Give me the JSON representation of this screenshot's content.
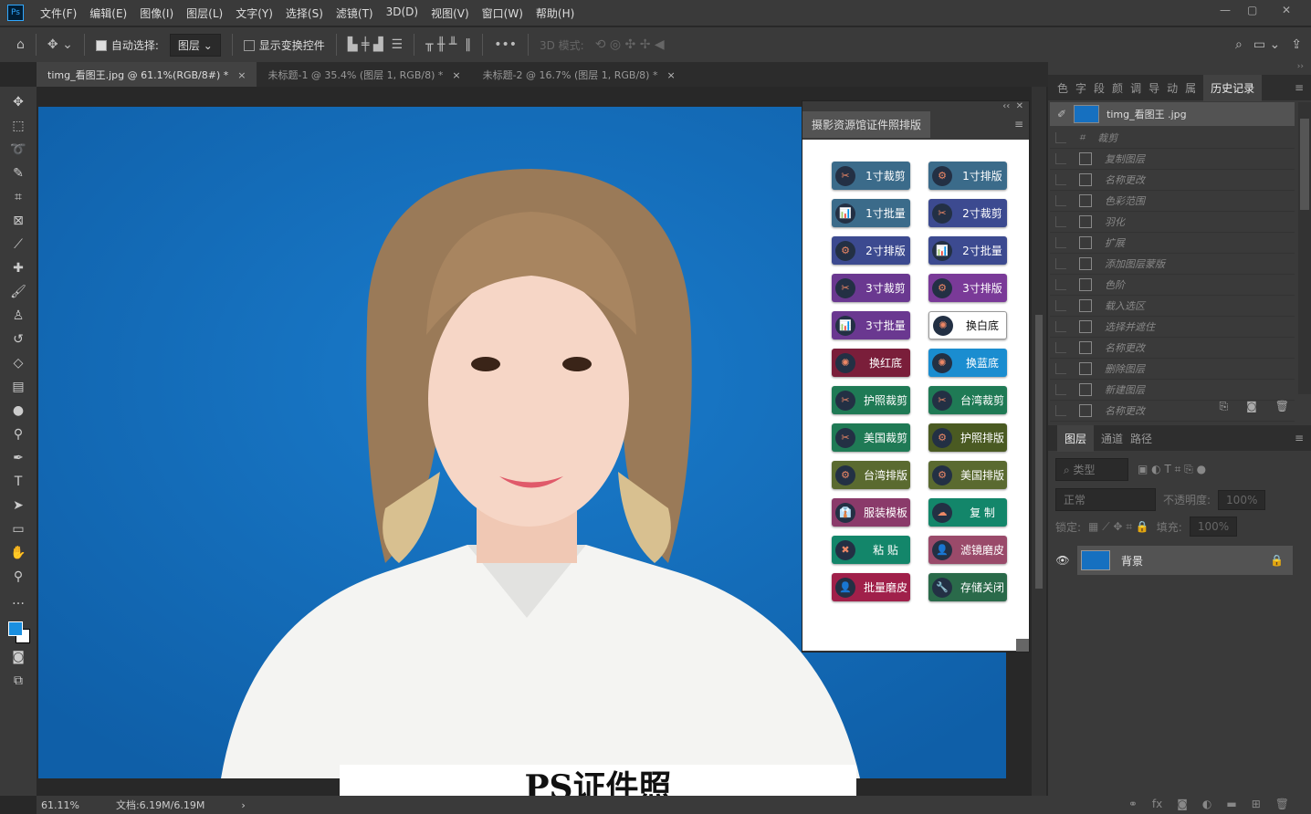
{
  "app": {
    "logo": "Ps",
    "menu": [
      "文件(F)",
      "编辑(E)",
      "图像(I)",
      "图层(L)",
      "文字(Y)",
      "选择(S)",
      "滤镜(T)",
      "3D(D)",
      "视图(V)",
      "窗口(W)",
      "帮助(H)"
    ]
  },
  "options": {
    "auto_select_label": "自动选择:",
    "auto_select_value": "图层",
    "transform_label": "显示变换控件",
    "mode_3d": "3D 模式:"
  },
  "tabs": [
    {
      "label": "timg_看图王.jpg @ 61.1%(RGB/8#) *",
      "active": true
    },
    {
      "label": "未标题-1 @ 35.4% (图层 1, RGB/8) *",
      "active": false
    },
    {
      "label": "未标题-2 @ 16.7% (图层 1, RGB/8) *",
      "active": false
    }
  ],
  "plugin": {
    "title": "摄影资源馆证件照排版",
    "buttons": [
      {
        "label": "1寸裁剪",
        "color": "#3b6b8a",
        "icon": "scissors"
      },
      {
        "label": "1寸排版",
        "color": "#3b6b8a",
        "icon": "gears"
      },
      {
        "label": "1寸批量",
        "color": "#3b6b8a",
        "icon": "chart"
      },
      {
        "label": "2寸裁剪",
        "color": "#3c4a90",
        "icon": "scissors"
      },
      {
        "label": "2寸排版",
        "color": "#3c4a90",
        "icon": "gears"
      },
      {
        "label": "2寸批量",
        "color": "#3c4a90",
        "icon": "chart"
      },
      {
        "label": "3寸裁剪",
        "color": "#6a3890",
        "icon": "scissors"
      },
      {
        "label": "3寸排版",
        "color": "#7a3a98",
        "icon": "gears"
      },
      {
        "label": "3寸批量",
        "color": "#6a3890",
        "icon": "chart"
      },
      {
        "label": "换白底",
        "color": "#ffffff",
        "icon": "nodes"
      },
      {
        "label": "换红底",
        "color": "#7a1e3a",
        "icon": "nodes"
      },
      {
        "label": "换蓝底",
        "color": "#1a8dd0",
        "icon": "nodes"
      },
      {
        "label": "护照裁剪",
        "color": "#1f7a55",
        "icon": "scissors"
      },
      {
        "label": "台湾裁剪",
        "color": "#1f7a55",
        "icon": "scissors"
      },
      {
        "label": "美国裁剪",
        "color": "#1f7a55",
        "icon": "scissors"
      },
      {
        "label": "护照排版",
        "color": "#4a5a22",
        "icon": "gears"
      },
      {
        "label": "台湾排版",
        "color": "#5a6a30",
        "icon": "gears"
      },
      {
        "label": "美国排版",
        "color": "#5a6a30",
        "icon": "gears"
      },
      {
        "label": "服装模板",
        "color": "#8a3a6a",
        "icon": "suit"
      },
      {
        "label": "复 制",
        "color": "#13866a",
        "icon": "cloud"
      },
      {
        "label": "粘 贴",
        "color": "#13866a",
        "icon": "tools"
      },
      {
        "label": "滤镜磨皮",
        "color": "#9a4a6a",
        "icon": "person"
      },
      {
        "label": "批量磨皮",
        "color": "#a0204a",
        "icon": "person"
      },
      {
        "label": "存储关闭",
        "color": "#2a6a4a",
        "icon": "wrench"
      }
    ]
  },
  "status": {
    "zoom": "61.11%",
    "doc": "文档:6.19M/6.19M"
  },
  "caption": "PS证件照",
  "right": {
    "top_tabs": [
      "色",
      "字",
      "段",
      "颜",
      "调",
      "导",
      "动",
      "属"
    ],
    "active_tab": "历史记录",
    "history_snapshot": "timg_看图王 .jpg",
    "history": [
      "裁剪",
      "复制图层",
      "名称更改",
      "色彩范围",
      "羽化",
      "扩展",
      "添加图层蒙版",
      "色阶",
      "载入选区",
      "选择并遮住",
      "名称更改",
      "删除图层",
      "新建图层",
      "名称更改"
    ],
    "layer_tabs": [
      "图层",
      "通道",
      "路径"
    ],
    "filter_placeholder": "类型",
    "blend": "正常",
    "opacity_label": "不透明度:",
    "opacity": "100%",
    "lock_label": "锁定:",
    "fill_label": "填充:",
    "fill": "100%",
    "layer_name": "背景"
  }
}
